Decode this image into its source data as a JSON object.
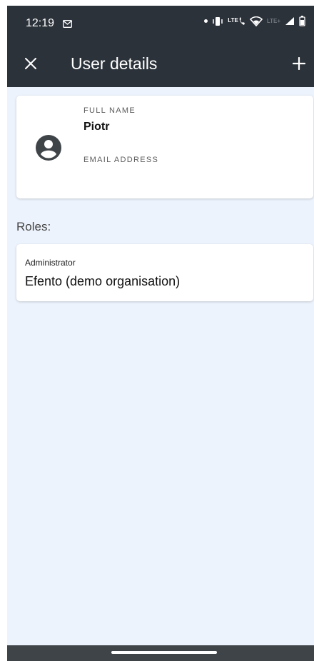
{
  "status_bar": {
    "time": "12:19",
    "lte_label": "LTE",
    "lte_plus_label": "LTE+",
    "icons": [
      "gmail-icon",
      "dot-icon",
      "vibrate-icon",
      "wifi-calling-icon",
      "wifi-icon",
      "signal-icon",
      "battery-icon"
    ]
  },
  "app_bar": {
    "title": "User details",
    "close_icon": "close-icon",
    "add_icon": "plus-icon",
    "background": "#2c323a"
  },
  "user_card": {
    "avatar_icon": "account-circle-icon",
    "full_name_label": "FULL NAME",
    "full_name": "Piotr",
    "email_label": "EMAIL ADDRESS",
    "email": ""
  },
  "roles": {
    "label": "Roles:",
    "items": [
      {
        "role": "Administrator",
        "organisation": "Efento (demo organisation)"
      }
    ]
  },
  "colors": {
    "background": "#edf3fc",
    "card": "#ffffff",
    "bar": "#2c323a"
  }
}
